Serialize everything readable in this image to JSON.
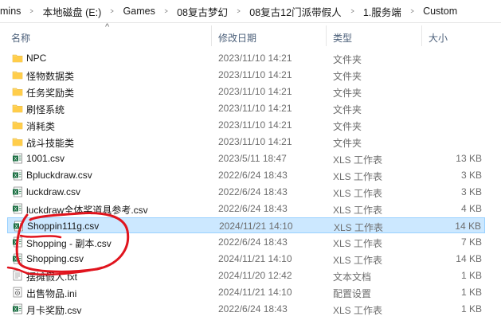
{
  "breadcrumb": [
    "mins",
    "本地磁盘 (E:)",
    "Games",
    "08复古梦幻",
    "08复古12门派带假人",
    "1.服务端",
    "Custom"
  ],
  "columns": {
    "name": "名称",
    "date": "修改日期",
    "type": "类型",
    "size": "大小"
  },
  "files": [
    {
      "name": "NPC",
      "date": "2023/11/10 14:21",
      "type": "文件夹",
      "size": "",
      "icon": "folder-icon"
    },
    {
      "name": "怪物数据类",
      "date": "2023/11/10 14:21",
      "type": "文件夹",
      "size": "",
      "icon": "folder-icon"
    },
    {
      "name": "任务奖励类",
      "date": "2023/11/10 14:21",
      "type": "文件夹",
      "size": "",
      "icon": "folder-icon"
    },
    {
      "name": "刷怪系统",
      "date": "2023/11/10 14:21",
      "type": "文件夹",
      "size": "",
      "icon": "folder-icon"
    },
    {
      "name": "消耗类",
      "date": "2023/11/10 14:21",
      "type": "文件夹",
      "size": "",
      "icon": "folder-icon"
    },
    {
      "name": "战斗技能类",
      "date": "2023/11/10 14:21",
      "type": "文件夹",
      "size": "",
      "icon": "folder-icon"
    },
    {
      "name": "1001.csv",
      "date": "2023/5/11 18:47",
      "type": "XLS 工作表",
      "size": "13 KB",
      "icon": "csv-file-icon"
    },
    {
      "name": "Bpluckdraw.csv",
      "date": "2022/6/24 18:43",
      "type": "XLS 工作表",
      "size": "3 KB",
      "icon": "csv-file-icon"
    },
    {
      "name": "luckdraw.csv",
      "date": "2022/6/24 18:43",
      "type": "XLS 工作表",
      "size": "3 KB",
      "icon": "csv-file-icon"
    },
    {
      "name": "luckdraw全体奖道具参考.csv",
      "date": "2022/6/24 18:43",
      "type": "XLS 工作表",
      "size": "4 KB",
      "icon": "csv-file-icon"
    },
    {
      "name": "Shoppin111g.csv",
      "date": "2024/11/21 14:10",
      "type": "XLS 工作表",
      "size": "14 KB",
      "icon": "csv-file-icon",
      "selected": true
    },
    {
      "name": "Shopping - 副本.csv",
      "date": "2022/6/24 18:43",
      "type": "XLS 工作表",
      "size": "7 KB",
      "icon": "csv-file-icon"
    },
    {
      "name": "Shopping.csv",
      "date": "2024/11/21 14:10",
      "type": "XLS 工作表",
      "size": "14 KB",
      "icon": "csv-file-icon"
    },
    {
      "name": "摆摊假人.txt",
      "date": "2024/11/20 12:42",
      "type": "文本文档",
      "size": "1 KB",
      "icon": "text-file-icon"
    },
    {
      "name": "出售物品.ini",
      "date": "2024/11/21 14:10",
      "type": "配置设置",
      "size": "1 KB",
      "icon": "ini-file-icon"
    },
    {
      "name": "月卡奖励.csv",
      "date": "2022/6/24 18:43",
      "type": "XLS 工作表",
      "size": "1 KB",
      "icon": "csv-file-icon"
    }
  ],
  "colors": {
    "selection": "#cce8ff",
    "selection_border": "#99d1ff",
    "folder": "#ffd666",
    "annotation": "#e0141e"
  }
}
